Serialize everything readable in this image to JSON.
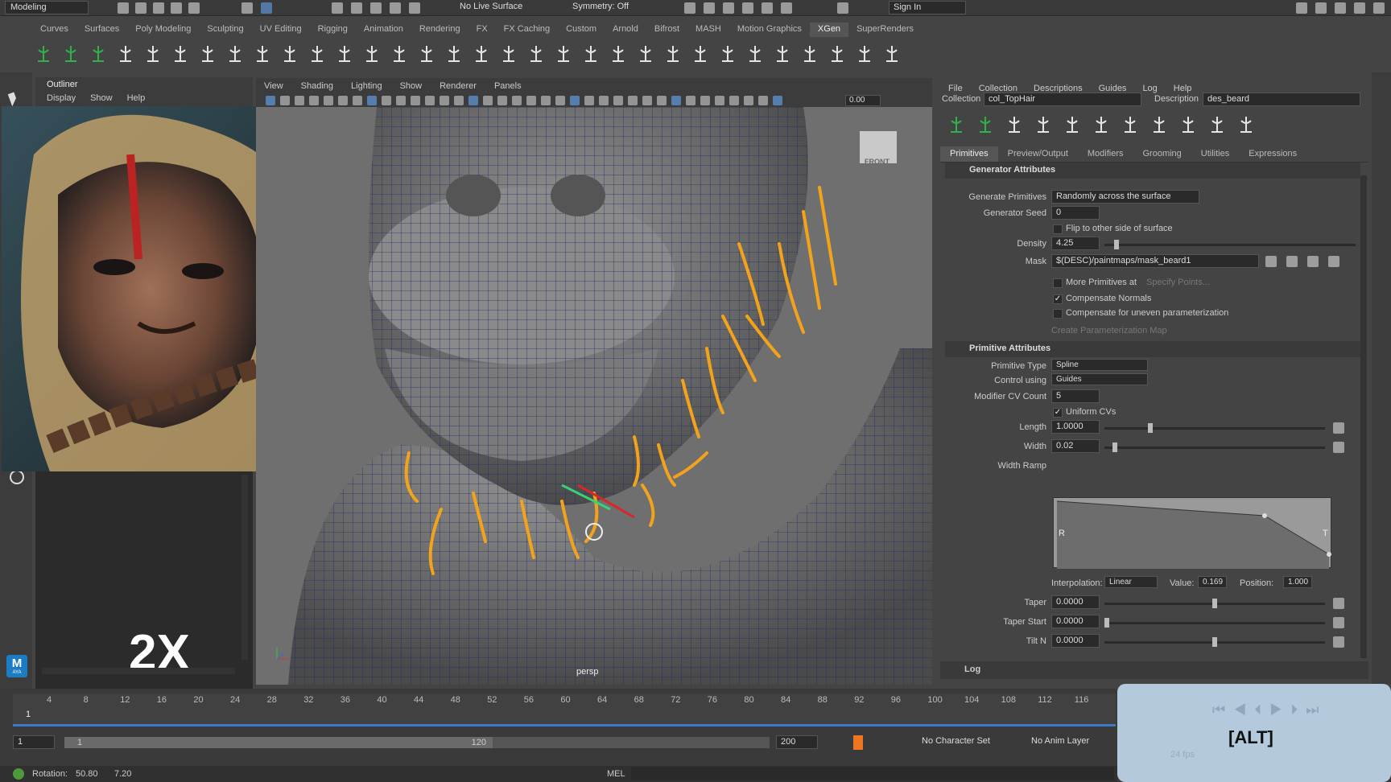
{
  "topbar": {
    "workspace": "Modeling",
    "live_surface": "No Live Surface",
    "symmetry": "Symmetry: Off",
    "sign_in": "Sign In"
  },
  "shelf_tabs": [
    "Curves",
    "Surfaces",
    "Poly Modeling",
    "Sculpting",
    "UV Editing",
    "Rigging",
    "Animation",
    "Rendering",
    "FX",
    "FX Caching",
    "Custom",
    "Arnold",
    "Bifrost",
    "MASH",
    "Motion Graphics",
    "XGen",
    "SuperRenders"
  ],
  "active_shelf_tab": "XGen",
  "outliner": {
    "title": "Outliner",
    "menu": [
      "Display",
      "Show",
      "Help"
    ],
    "speed_label": "2X",
    "maya_badge": "M",
    "maya_badge_sub": "AYA"
  },
  "viewport": {
    "menu": [
      "View",
      "Shading",
      "Lighting",
      "Show",
      "Renderer",
      "Panels"
    ],
    "field_value": "0.00",
    "camera_label": "persp",
    "cube_label": "FRONT"
  },
  "xgen": {
    "menu": [
      "File",
      "Collection",
      "Descriptions",
      "Guides",
      "Log",
      "Help"
    ],
    "collection_label": "Collection",
    "collection_value": "col_TopHair",
    "description_label": "Description",
    "description_value": "des_beard",
    "tabs": [
      "Primitives",
      "Preview/Output",
      "Modifiers",
      "Grooming",
      "Utilities",
      "Expressions"
    ],
    "active_tab": "Primitives",
    "generator_section": "Generator Attributes",
    "generate_primitives_label": "Generate Primitives",
    "generate_primitives_value": "Randomly across the surface",
    "generator_seed_label": "Generator Seed",
    "generator_seed_value": "0",
    "flip_label": "Flip to other side of surface",
    "density_label": "Density",
    "density_value": "4.25",
    "density_level": 0.05,
    "mask_label": "Mask",
    "mask_value": "$(DESC)/paintmaps/mask_beard1",
    "more_primitives_label": "More Primitives at",
    "specify_points": "Specify Points...",
    "compensate_normals": "Compensate Normals",
    "compensate_uneven": "Compensate for uneven parameterization",
    "create_param_map": "Create Parameterization Map",
    "primitive_section": "Primitive Attributes",
    "primitive_type_label": "Primitive Type",
    "primitive_type_value": "Spline",
    "control_using_label": "Control using",
    "control_using_value": "Guides",
    "modifier_cv_label": "Modifier CV Count",
    "modifier_cv_value": "5",
    "uniform_cvs": "Uniform CVs",
    "length_label": "Length",
    "length_value": "1.0000",
    "width_label": "Width",
    "width_value": "0.02",
    "width_ramp_label": "Width Ramp",
    "ramp_r": "R",
    "ramp_t": "T",
    "interpolation_label": "Interpolation:",
    "interpolation_value": "Linear",
    "value_label": "Value:",
    "value_value": "0.169",
    "position_label": "Position:",
    "position_value": "1.000",
    "taper_label": "Taper",
    "taper_value": "0.0000",
    "taper_start_label": "Taper Start",
    "taper_start_value": "0.0000",
    "tiltn_label": "Tilt N",
    "tiltn_value": "0.0000",
    "log_label": "Log"
  },
  "timeline": {
    "ticks": [
      "4",
      "8",
      "12",
      "16",
      "20",
      "24",
      "28",
      "32",
      "36",
      "40",
      "44",
      "48",
      "52",
      "56",
      "60",
      "64",
      "68",
      "72",
      "76",
      "80",
      "84",
      "88",
      "92",
      "96",
      "100",
      "104",
      "108",
      "112",
      "116"
    ],
    "current_frame": "1",
    "start_frame": "1",
    "range_start": "1",
    "range_end": "120",
    "end_frame": "200",
    "character_set": "No Character Set",
    "anim_layer": "No Anim Layer",
    "fps": "24 fps"
  },
  "status": {
    "rotation_label": "Rotation:",
    "rotation_x": "50.80",
    "rotation_y": "7.20",
    "mel": "MEL"
  },
  "alt_overlay": "[ALT]",
  "colors": {
    "guide_orange": "#f3a21b",
    "wire": "#1e2f66",
    "accent_green": "#2fb24a"
  }
}
